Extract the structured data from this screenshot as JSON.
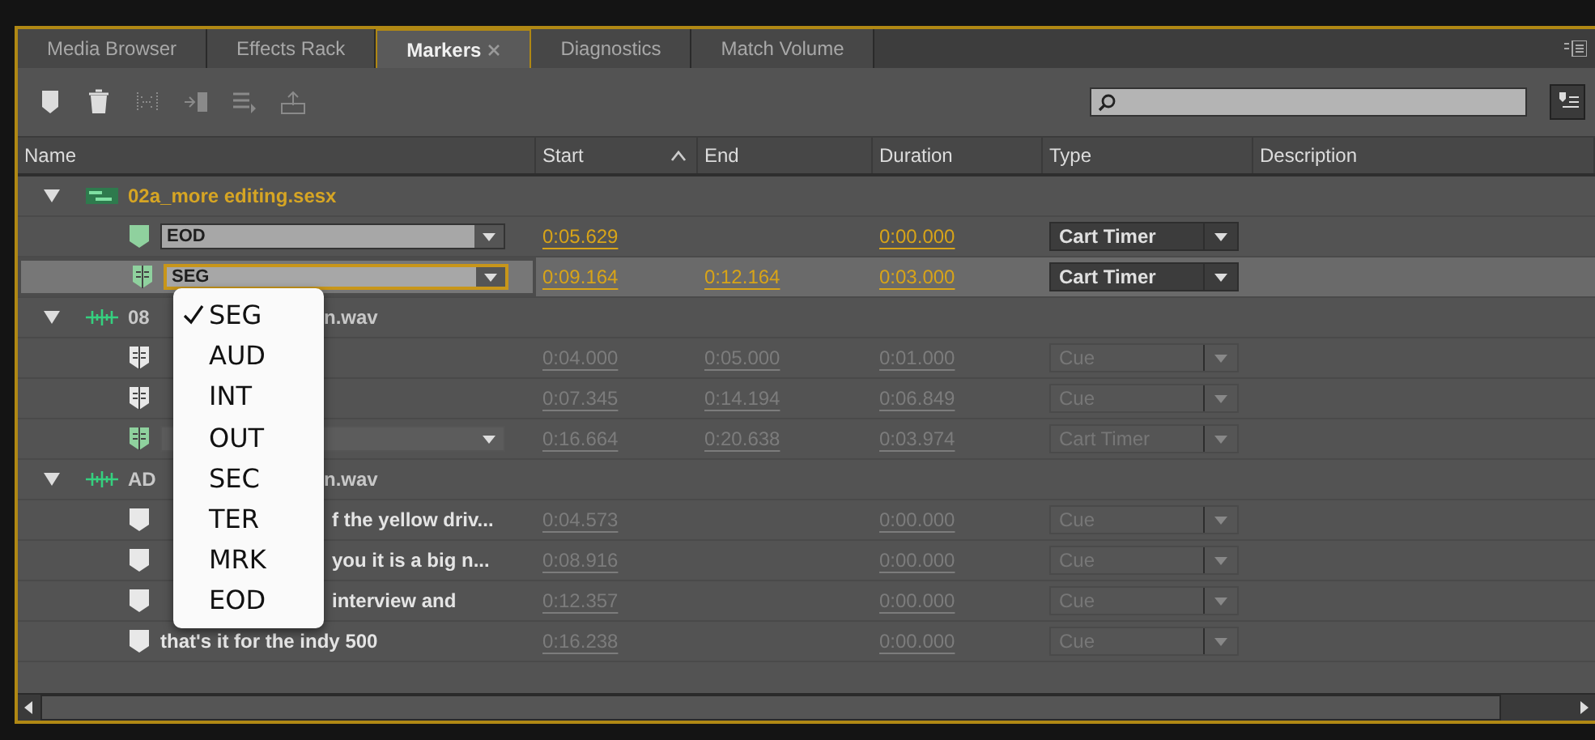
{
  "tabs": [
    {
      "label": "Media Browser",
      "selected": false
    },
    {
      "label": "Effects Rack",
      "selected": false
    },
    {
      "label": "Markers",
      "selected": true,
      "closable": true
    },
    {
      "label": "Diagnostics",
      "selected": false
    },
    {
      "label": "Match Volume",
      "selected": false
    }
  ],
  "toolbar": [
    {
      "kind": "marker",
      "disabled": false
    },
    {
      "kind": "trash",
      "disabled": false
    },
    {
      "kind": "merge",
      "disabled": true
    },
    {
      "kind": "insert",
      "disabled": true
    },
    {
      "kind": "playlist",
      "disabled": true
    },
    {
      "kind": "export",
      "disabled": true
    }
  ],
  "columns": [
    {
      "label": "Name"
    },
    {
      "label": "Start",
      "sorted": true
    },
    {
      "label": "End"
    },
    {
      "label": "Duration"
    },
    {
      "label": "Type"
    },
    {
      "label": "Description"
    }
  ],
  "groups": [
    {
      "kind": "session",
      "expanded": true,
      "active": true,
      "name": "02a_more editing.sesx",
      "markers": [
        {
          "kind": "point",
          "color": "#8fd19e",
          "name_field": {
            "value": "EOD",
            "focused": false
          },
          "selected": false,
          "start": "0:05.629",
          "duration": "0:00.000",
          "type": "Cart Timer"
        },
        {
          "kind": "range",
          "color": "#8fd19e",
          "name_field": {
            "value": "SEG",
            "focused": true,
            "menu": [
              {
                "label": "SEG",
                "selected": true
              },
              {
                "label": "AUD",
                "selected": false
              },
              {
                "label": "INT",
                "selected": false
              },
              {
                "label": "OUT",
                "selected": false
              },
              {
                "label": "SEC",
                "selected": false
              },
              {
                "label": "TER",
                "selected": false
              },
              {
                "label": "MRK",
                "selected": false
              },
              {
                "label": "EOD",
                "selected": false
              }
            ]
          },
          "selected": true,
          "start": "0:09.164",
          "end": "0:12.164",
          "duration": "0:03.000",
          "type": "Cart Timer"
        }
      ]
    },
    {
      "kind": "wave",
      "expanded": true,
      "active": false,
      "name": "08",
      "name_end": "n.wav",
      "markers": [
        {
          "kind": "range",
          "color": "#e8e8e8",
          "selected": false,
          "start": "0:04.000",
          "end": "0:05.000",
          "duration": "0:01.000",
          "type": "Cue"
        },
        {
          "kind": "range",
          "color": "#e8e8e8",
          "selected": false,
          "start": "0:07.345",
          "end": "0:14.194",
          "duration": "0:06.849",
          "type": "Cue"
        },
        {
          "kind": "range",
          "color": "#8fd19e",
          "name_field": {
            "focused": false
          },
          "selected": false,
          "start": "0:16.664",
          "end": "0:20.638",
          "duration": "0:03.974",
          "type": "Cart Timer"
        }
      ]
    },
    {
      "kind": "wave",
      "expanded": true,
      "active": false,
      "name": "AD",
      "name_end": "n.wav",
      "markers": [
        {
          "kind": "point",
          "color": "#e8e8e8",
          "name": "f the yellow driv...",
          "covered": true,
          "selected": false,
          "start": "0:04.573",
          "duration": "0:00.000",
          "type": "Cue"
        },
        {
          "kind": "point",
          "color": "#e8e8e8",
          "name": "you it is a big n...",
          "covered": true,
          "selected": false,
          "start": "0:08.916",
          "duration": "0:00.000",
          "type": "Cue"
        },
        {
          "kind": "point",
          "color": "#e8e8e8",
          "name": "interview and",
          "covered": true,
          "selected": false,
          "start": "0:12.357",
          "duration": "0:00.000",
          "type": "Cue"
        },
        {
          "kind": "point",
          "color": "#e8e8e8",
          "name": "that's it for the indy 500",
          "covered": false,
          "selected": false,
          "start": "0:16.238",
          "duration": "0:00.000",
          "type": "Cue"
        }
      ]
    }
  ]
}
